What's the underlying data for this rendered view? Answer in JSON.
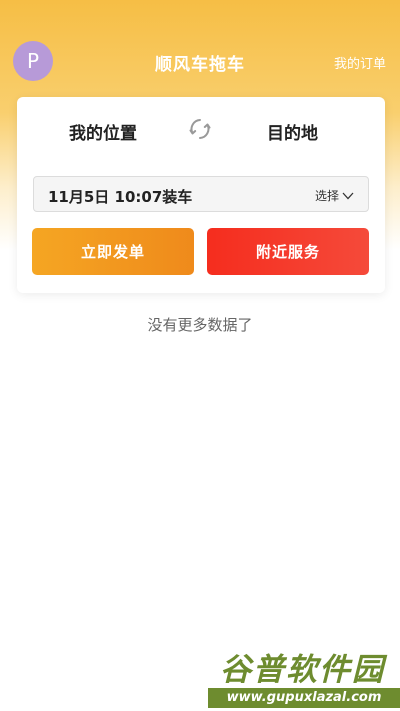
{
  "header": {
    "avatar_letter": "P",
    "title": "顺风车拖车",
    "orders_link": "我的订单"
  },
  "card": {
    "origin": "我的位置",
    "destination": "目的地",
    "time": "11月5日 10:07装车",
    "select_label": "选择",
    "send_button": "立即发单",
    "nearby_button": "附近服务"
  },
  "status": {
    "no_more": "没有更多数据了"
  },
  "watermark": {
    "title": "谷普软件园",
    "url": "www.gupuxlazal.com"
  },
  "colors": {
    "header_gradient_top": "#f6be45",
    "avatar": "#b79ad8",
    "send_button": "#f5a623",
    "nearby_button": "#f52d1e",
    "watermark_green": "#6e8c2f"
  },
  "icons": {
    "swap": "refresh-swap-icon",
    "select": "chevron-down-icon"
  }
}
